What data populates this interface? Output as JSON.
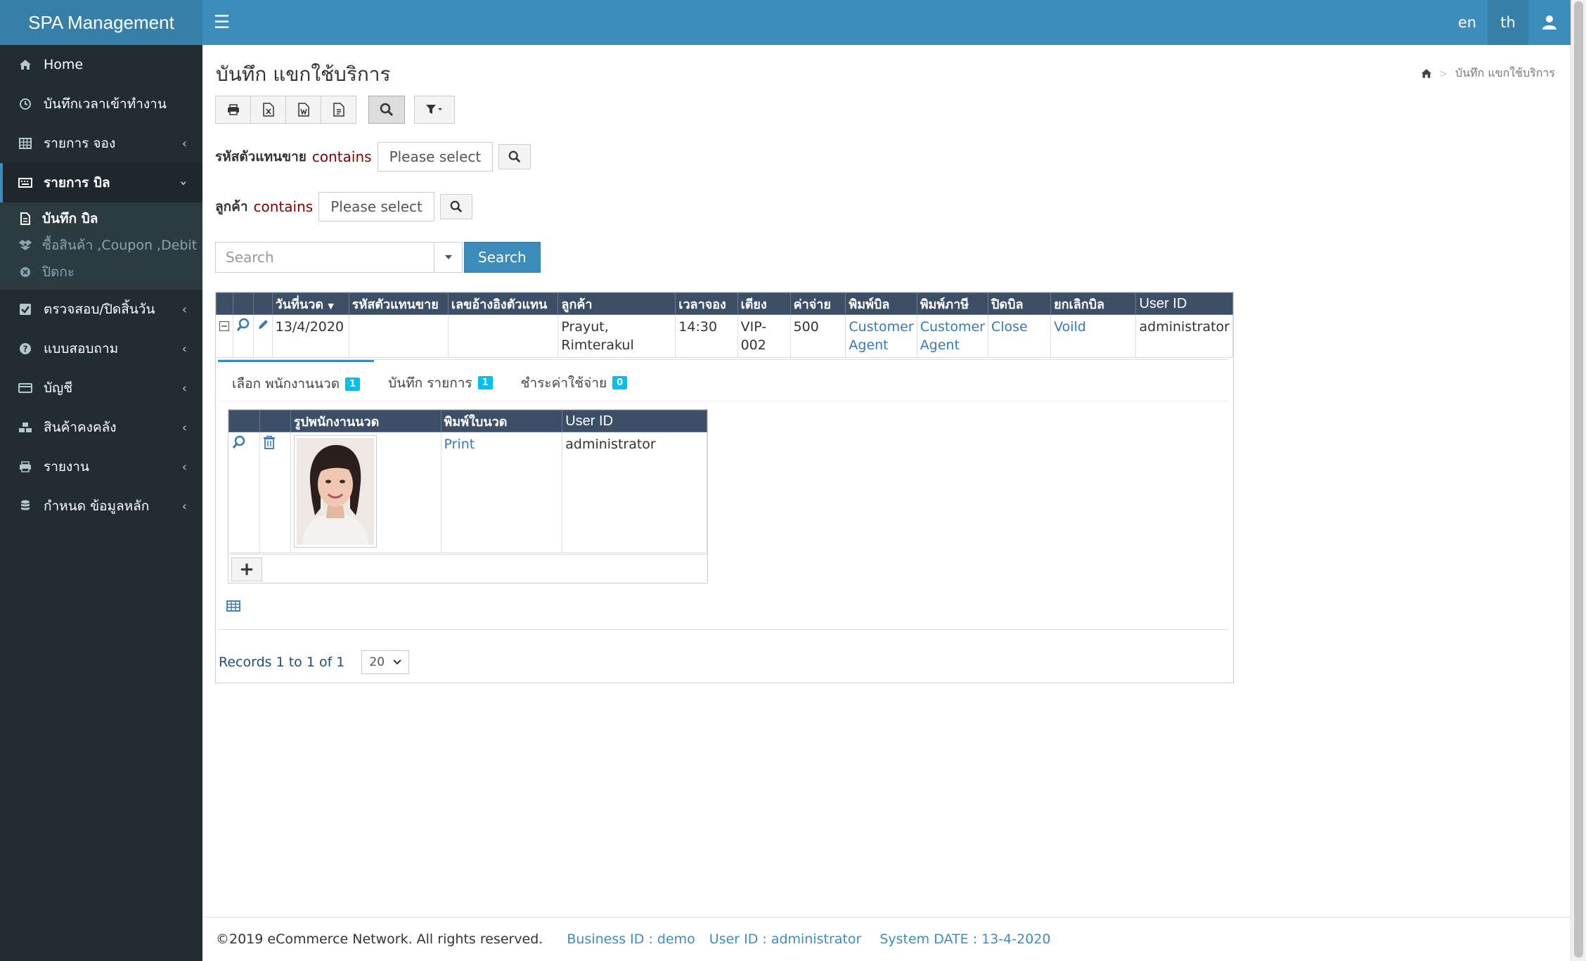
{
  "app": {
    "title": "SPA Management"
  },
  "header": {
    "lang_en": "en",
    "lang_th": "th"
  },
  "sidebar": {
    "items": [
      {
        "label": "Home"
      },
      {
        "label": "บันทึกเวลาเข้าทำงาน"
      },
      {
        "label": "รายการ จอง"
      },
      {
        "label": "รายการ บิล"
      },
      {
        "label": "ตรวจสอบ/ปิดสิ้นวัน"
      },
      {
        "label": "แบบสอบถาม"
      },
      {
        "label": "บัญชี"
      },
      {
        "label": "สินค้าคงคลัง"
      },
      {
        "label": "รายงาน"
      },
      {
        "label": "กำหนด ข้อมูลหลัก"
      }
    ],
    "submenu": [
      {
        "label": "บันทึก บิล"
      },
      {
        "label": "ซื้อสินค้า ,Coupon ,Debit"
      },
      {
        "label": "ปิดกะ"
      }
    ]
  },
  "page": {
    "title": "บันทึก แขกใช้บริการ",
    "breadcrumb": "บันทึก แขกใช้บริการ"
  },
  "filters": {
    "agent": {
      "label": "รหัสตัวแทนขาย",
      "op": "contains",
      "placeholder": "Please select"
    },
    "customer": {
      "label": "ลูกค้า",
      "op": "contains",
      "placeholder": "Please select"
    }
  },
  "search": {
    "placeholder": "Search",
    "button": "Search"
  },
  "grid": {
    "headers": [
      "วันที่นวด",
      "รหัสตัวแทนขาย",
      "เลขอ้างอิงตัวแทน",
      "ลูกค้า",
      "เวลาจอง",
      "เตียง",
      "ค่าจ่าย",
      "พิมพ์บิล",
      "พิมพ์ภาษี",
      "ปิดบิล",
      "ยกเลิกบิล",
      "User ID"
    ],
    "row": {
      "date": "13/4/2020",
      "agent_code": "",
      "agent_ref": "",
      "customer": "Prayut, Rimterakul",
      "time": "14:30",
      "bed": "VIP-002",
      "amount": "500",
      "print_bill_1": "Customer",
      "print_bill_2": "Agent",
      "print_tax_1": "Customer",
      "print_tax_2": "Agent",
      "close": "Close",
      "void": "Voild",
      "user": "administrator"
    }
  },
  "detail": {
    "tabs": [
      {
        "label": "เลือก พนักงานนวด",
        "count": "1"
      },
      {
        "label": "บันทึก รายการ",
        "count": "1"
      },
      {
        "label": "ชำระค่าใช้จ่าย",
        "count": "0"
      }
    ],
    "subgrid": {
      "headers": [
        "รูปพนักงานนวด",
        "พิมพ์ใบนวด",
        "User ID"
      ],
      "row": {
        "print": "Print",
        "user": "administrator"
      },
      "add": "+"
    }
  },
  "pager": {
    "records": "Records 1 to 1 of 1",
    "page_size": "20"
  },
  "footer": {
    "copyright": "©2019 eCommerce Network. All rights reserved.",
    "business": "Business ID : demo",
    "user": "User ID : administrator",
    "date": "System DATE : 13-4-2020"
  },
  "colors": {
    "header": "#3c8dbc",
    "sidebar": "#222d32",
    "grid_header": "#3d4f66",
    "badge": "#00c0ef",
    "link": "#337ab7"
  }
}
